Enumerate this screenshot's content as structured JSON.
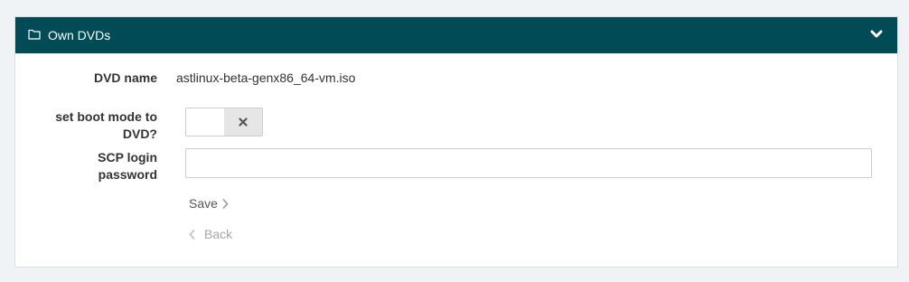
{
  "panel": {
    "title": "Own DVDs",
    "header_color": "#004b56",
    "header_icon": "folder-icon",
    "collapse_icon": "chevron-down-icon"
  },
  "form": {
    "dvd_name_label": "DVD name",
    "dvd_name_value": "astlinux-beta-genx86_64-vm.iso",
    "boot_mode_label_line1": "set boot mode to",
    "boot_mode_label_line2": "DVD?",
    "boot_mode_state": "off",
    "scp_label_line1": "SCP login",
    "scp_label_line2": "password",
    "scp_password_value": ""
  },
  "actions": {
    "save_label": "Save",
    "back_label": "Back"
  }
}
